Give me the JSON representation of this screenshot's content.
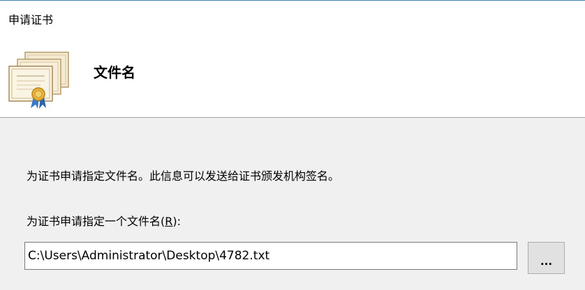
{
  "header": {
    "wizard_title": "申请证书",
    "page_heading": "文件名",
    "icon": "certificate-stack-icon"
  },
  "main": {
    "description": "为证书申请指定文件名。此信息可以发送给证书颁发机构签名。",
    "field_label_prefix": "为证书申请指定一个文件名(",
    "field_label_accel": "R",
    "field_label_suffix": "):",
    "file_path_value": "C:\\Users\\Administrator\\Desktop\\4782.txt",
    "browse_label": "..."
  },
  "colors": {
    "header_bg": "#ffffff",
    "body_bg": "#f0f0f0",
    "button_bg": "#e1e1e1",
    "input_border": "#7a7a7a"
  }
}
